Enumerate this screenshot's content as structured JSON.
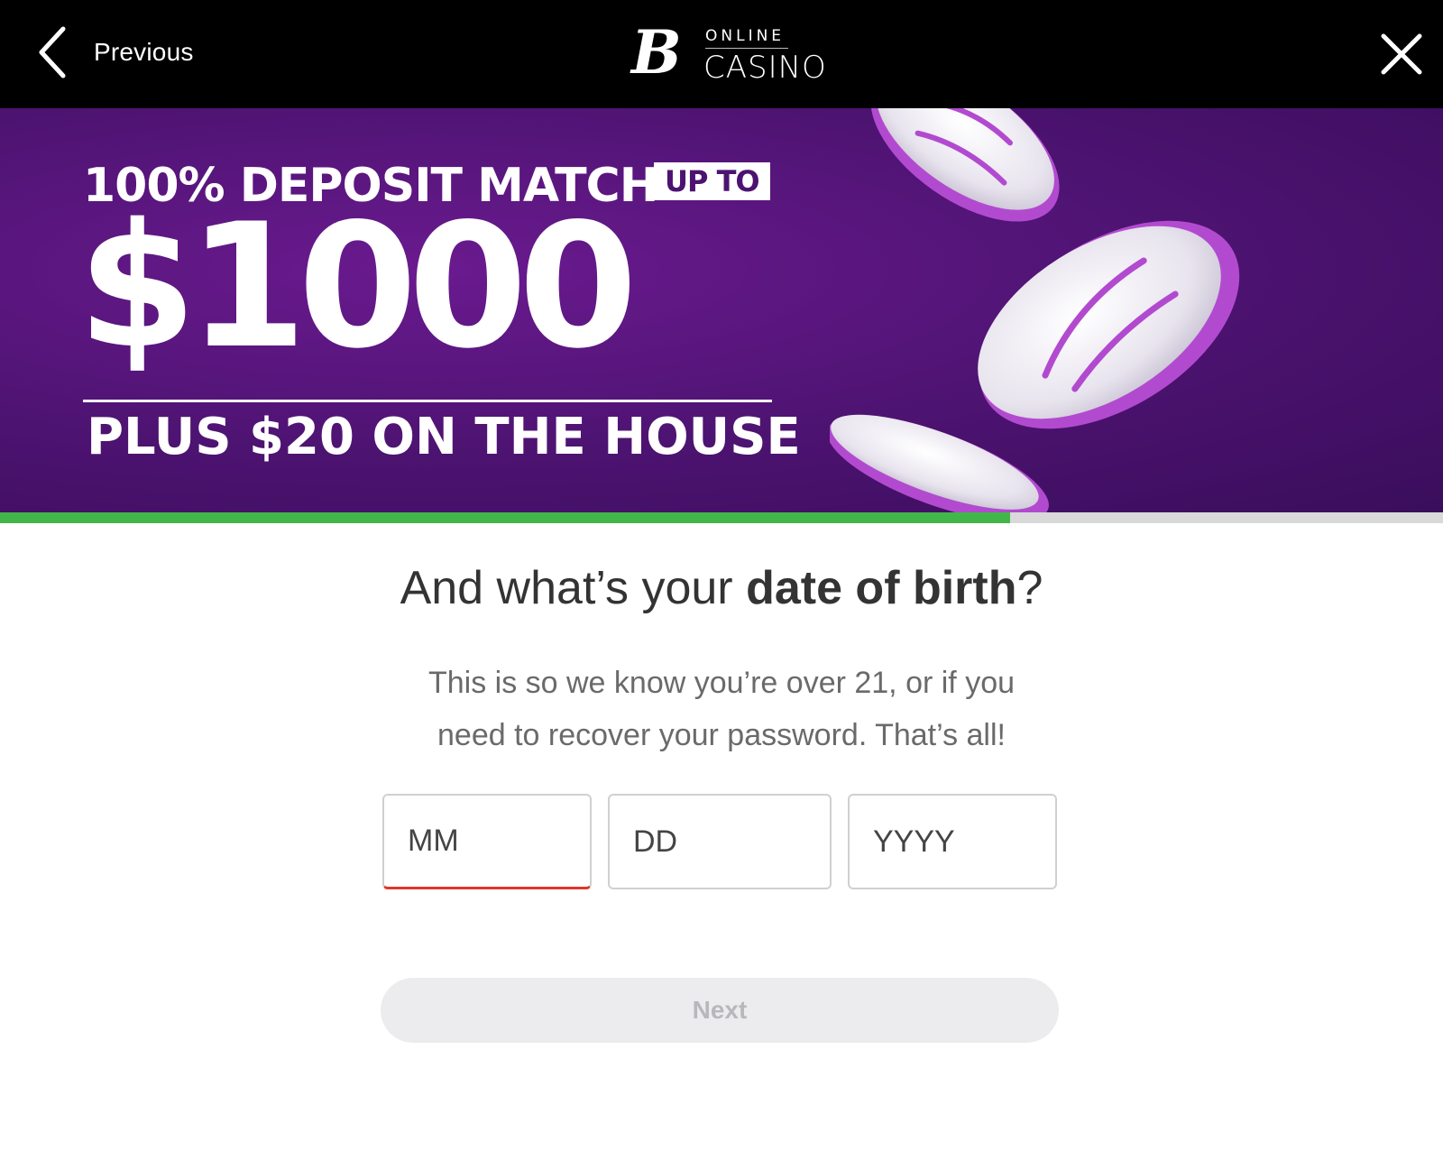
{
  "topbar": {
    "previous_label": "Previous",
    "logo": {
      "letter": "B",
      "line1": "ONLINE",
      "line2": "CASINO"
    },
    "icons": {
      "back": "chevron-left-icon",
      "close": "close-icon"
    }
  },
  "banner": {
    "line1": "100% DEPOSIT MATCH",
    "badge": "UP TO",
    "amount": "$1000",
    "line2": "PLUS $20 ON THE HOUSE"
  },
  "progress": {
    "fraction": 0.7,
    "fill_color": "#43b649"
  },
  "form": {
    "heading_pre": "And what’s your ",
    "heading_bold": "date of birth",
    "heading_post": "?",
    "subtext": "This is so we know you’re over 21, or if you need to recover your password. That’s all!",
    "month_placeholder": "MM",
    "day_placeholder": "DD",
    "year_placeholder": "YYYY",
    "month_value": "",
    "day_value": "",
    "year_value": "",
    "next_label": "Next"
  },
  "colors": {
    "brand_purple": "#4c1370",
    "error_underline": "#e0362b",
    "progress_green": "#43b649"
  }
}
